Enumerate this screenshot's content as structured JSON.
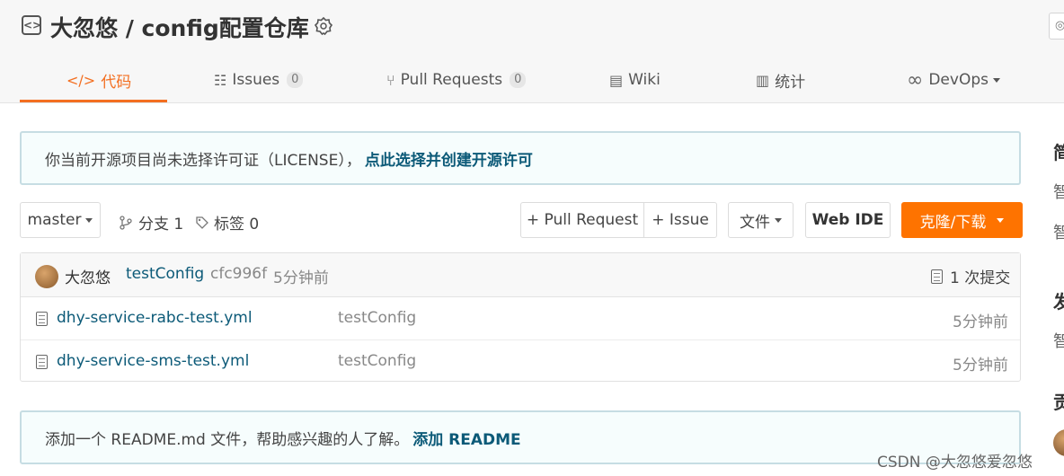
{
  "header": {
    "repo_title": "大忽悠 / config配置仓库",
    "watch_label": "◎"
  },
  "tabs": [
    {
      "label": "代码",
      "icon": "code-icon",
      "glyph": "</>",
      "active": true
    },
    {
      "label": "Issues",
      "icon": "issues-icon",
      "glyph": "☷",
      "count": "0"
    },
    {
      "label": "Pull Requests",
      "icon": "pull-request-icon",
      "glyph": "⑂",
      "count": "0"
    },
    {
      "label": "Wiki",
      "icon": "wiki-icon",
      "glyph": "▤"
    },
    {
      "label": "统计",
      "icon": "stats-icon",
      "glyph": "▥"
    },
    {
      "label": "DevOps",
      "icon": "infinity-icon",
      "glyph": "∞"
    }
  ],
  "license_notice": {
    "text": "你当前开源项目尚未选择许可证（LICENSE），",
    "link": "点此选择并创建开源许可"
  },
  "toolbar": {
    "branch": "master",
    "branches_label": "分支 1",
    "tags_label": "标签 0",
    "pull_request_btn": "+ Pull Request",
    "issue_btn": "+ Issue",
    "file_btn": "文件",
    "webide_btn": "Web IDE",
    "clone_btn": "克隆/下载"
  },
  "commit": {
    "author": "大忽悠",
    "message": "testConfig",
    "hash": "cfc996f",
    "time": "5分钟前",
    "count_label": "1 次提交"
  },
  "files": [
    {
      "name": "dhy-service-rabc-test.yml",
      "commit": "testConfig",
      "time": "5分钟前"
    },
    {
      "name": "dhy-service-sms-test.yml",
      "commit": "testConfig",
      "time": "5分钟前"
    }
  ],
  "readme_notice": {
    "text": "添加一个 README.md 文件，帮助感兴趣的人了解。",
    "link": "添加 README"
  },
  "sidebar_partial": [
    "简",
    "智",
    "智",
    "发",
    "智",
    "贡"
  ],
  "watermark": "CSDN @大忽悠爱忽悠",
  "colors": {
    "accent": "#f36f21",
    "clone": "#fe7300",
    "link": "#0c5a78"
  }
}
